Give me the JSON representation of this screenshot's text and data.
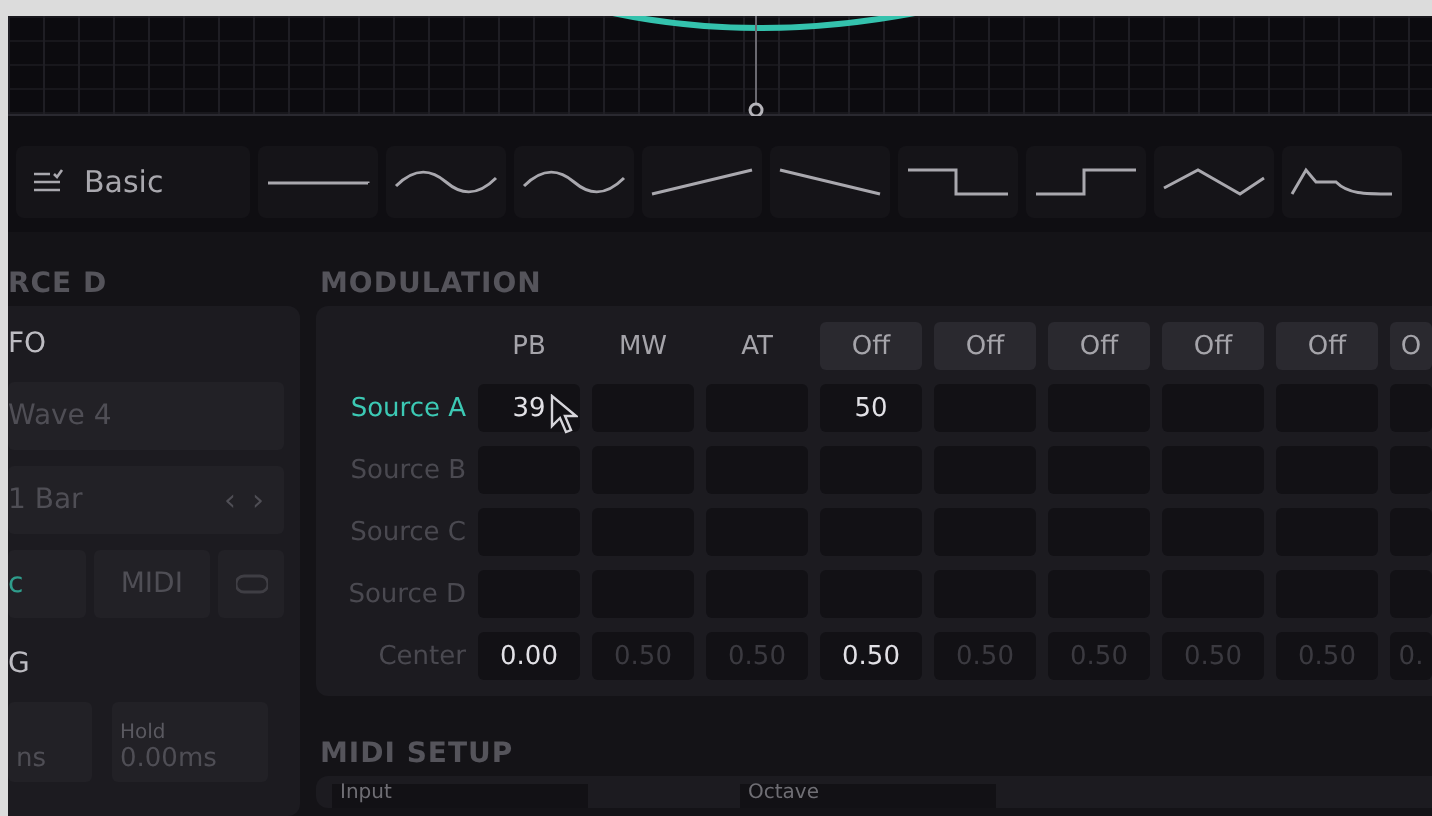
{
  "presets": {
    "label": "Basic",
    "shapes": [
      {
        "kind": "flat"
      },
      {
        "kind": "sine"
      },
      {
        "kind": "sine"
      },
      {
        "kind": "ramp-up"
      },
      {
        "kind": "ramp-down"
      },
      {
        "kind": "step-down"
      },
      {
        "kind": "step-up"
      },
      {
        "kind": "triangle"
      },
      {
        "kind": "envelope"
      }
    ]
  },
  "source_panel": {
    "title": "RCE D",
    "lfo_title": "FO",
    "wave": "Wave 4",
    "rate": "1 Bar",
    "prev": "‹",
    "next": "›",
    "sync": "c",
    "midi": "MIDI",
    "env_title": "G",
    "attack_value": "ns",
    "hold_label": "Hold",
    "hold_value": "0.00ms"
  },
  "modulation": {
    "title": "MODULATION",
    "columns": [
      {
        "label": "PB",
        "boxed": false
      },
      {
        "label": "MW",
        "boxed": false
      },
      {
        "label": "AT",
        "boxed": false
      },
      {
        "label": "Off",
        "boxed": true
      },
      {
        "label": "Off",
        "boxed": true
      },
      {
        "label": "Off",
        "boxed": true
      },
      {
        "label": "Off",
        "boxed": true
      },
      {
        "label": "Off",
        "boxed": true
      },
      {
        "label": "O",
        "boxed": true
      }
    ],
    "rows": [
      {
        "label": "Source A",
        "selected": true,
        "cells": [
          "39",
          "",
          "",
          "50",
          "",
          "",
          "",
          "",
          ""
        ]
      },
      {
        "label": "Source B",
        "selected": false,
        "cells": [
          "",
          "",
          "",
          "",
          "",
          "",
          "",
          "",
          ""
        ]
      },
      {
        "label": "Source C",
        "selected": false,
        "cells": [
          "",
          "",
          "",
          "",
          "",
          "",
          "",
          "",
          ""
        ]
      },
      {
        "label": "Source D",
        "selected": false,
        "cells": [
          "",
          "",
          "",
          "",
          "",
          "",
          "",
          "",
          ""
        ]
      }
    ],
    "center": {
      "label": "Center",
      "cells": [
        {
          "value": "0.00",
          "active": true
        },
        {
          "value": "0.50",
          "active": false
        },
        {
          "value": "0.50",
          "active": false
        },
        {
          "value": "0.50",
          "active": true
        },
        {
          "value": "0.50",
          "active": false
        },
        {
          "value": "0.50",
          "active": false
        },
        {
          "value": "0.50",
          "active": false
        },
        {
          "value": "0.50",
          "active": false
        },
        {
          "value": "0.",
          "active": false
        }
      ]
    }
  },
  "midi_setup": {
    "title": "MIDI SETUP",
    "fields": [
      "Input",
      "Octave"
    ]
  }
}
